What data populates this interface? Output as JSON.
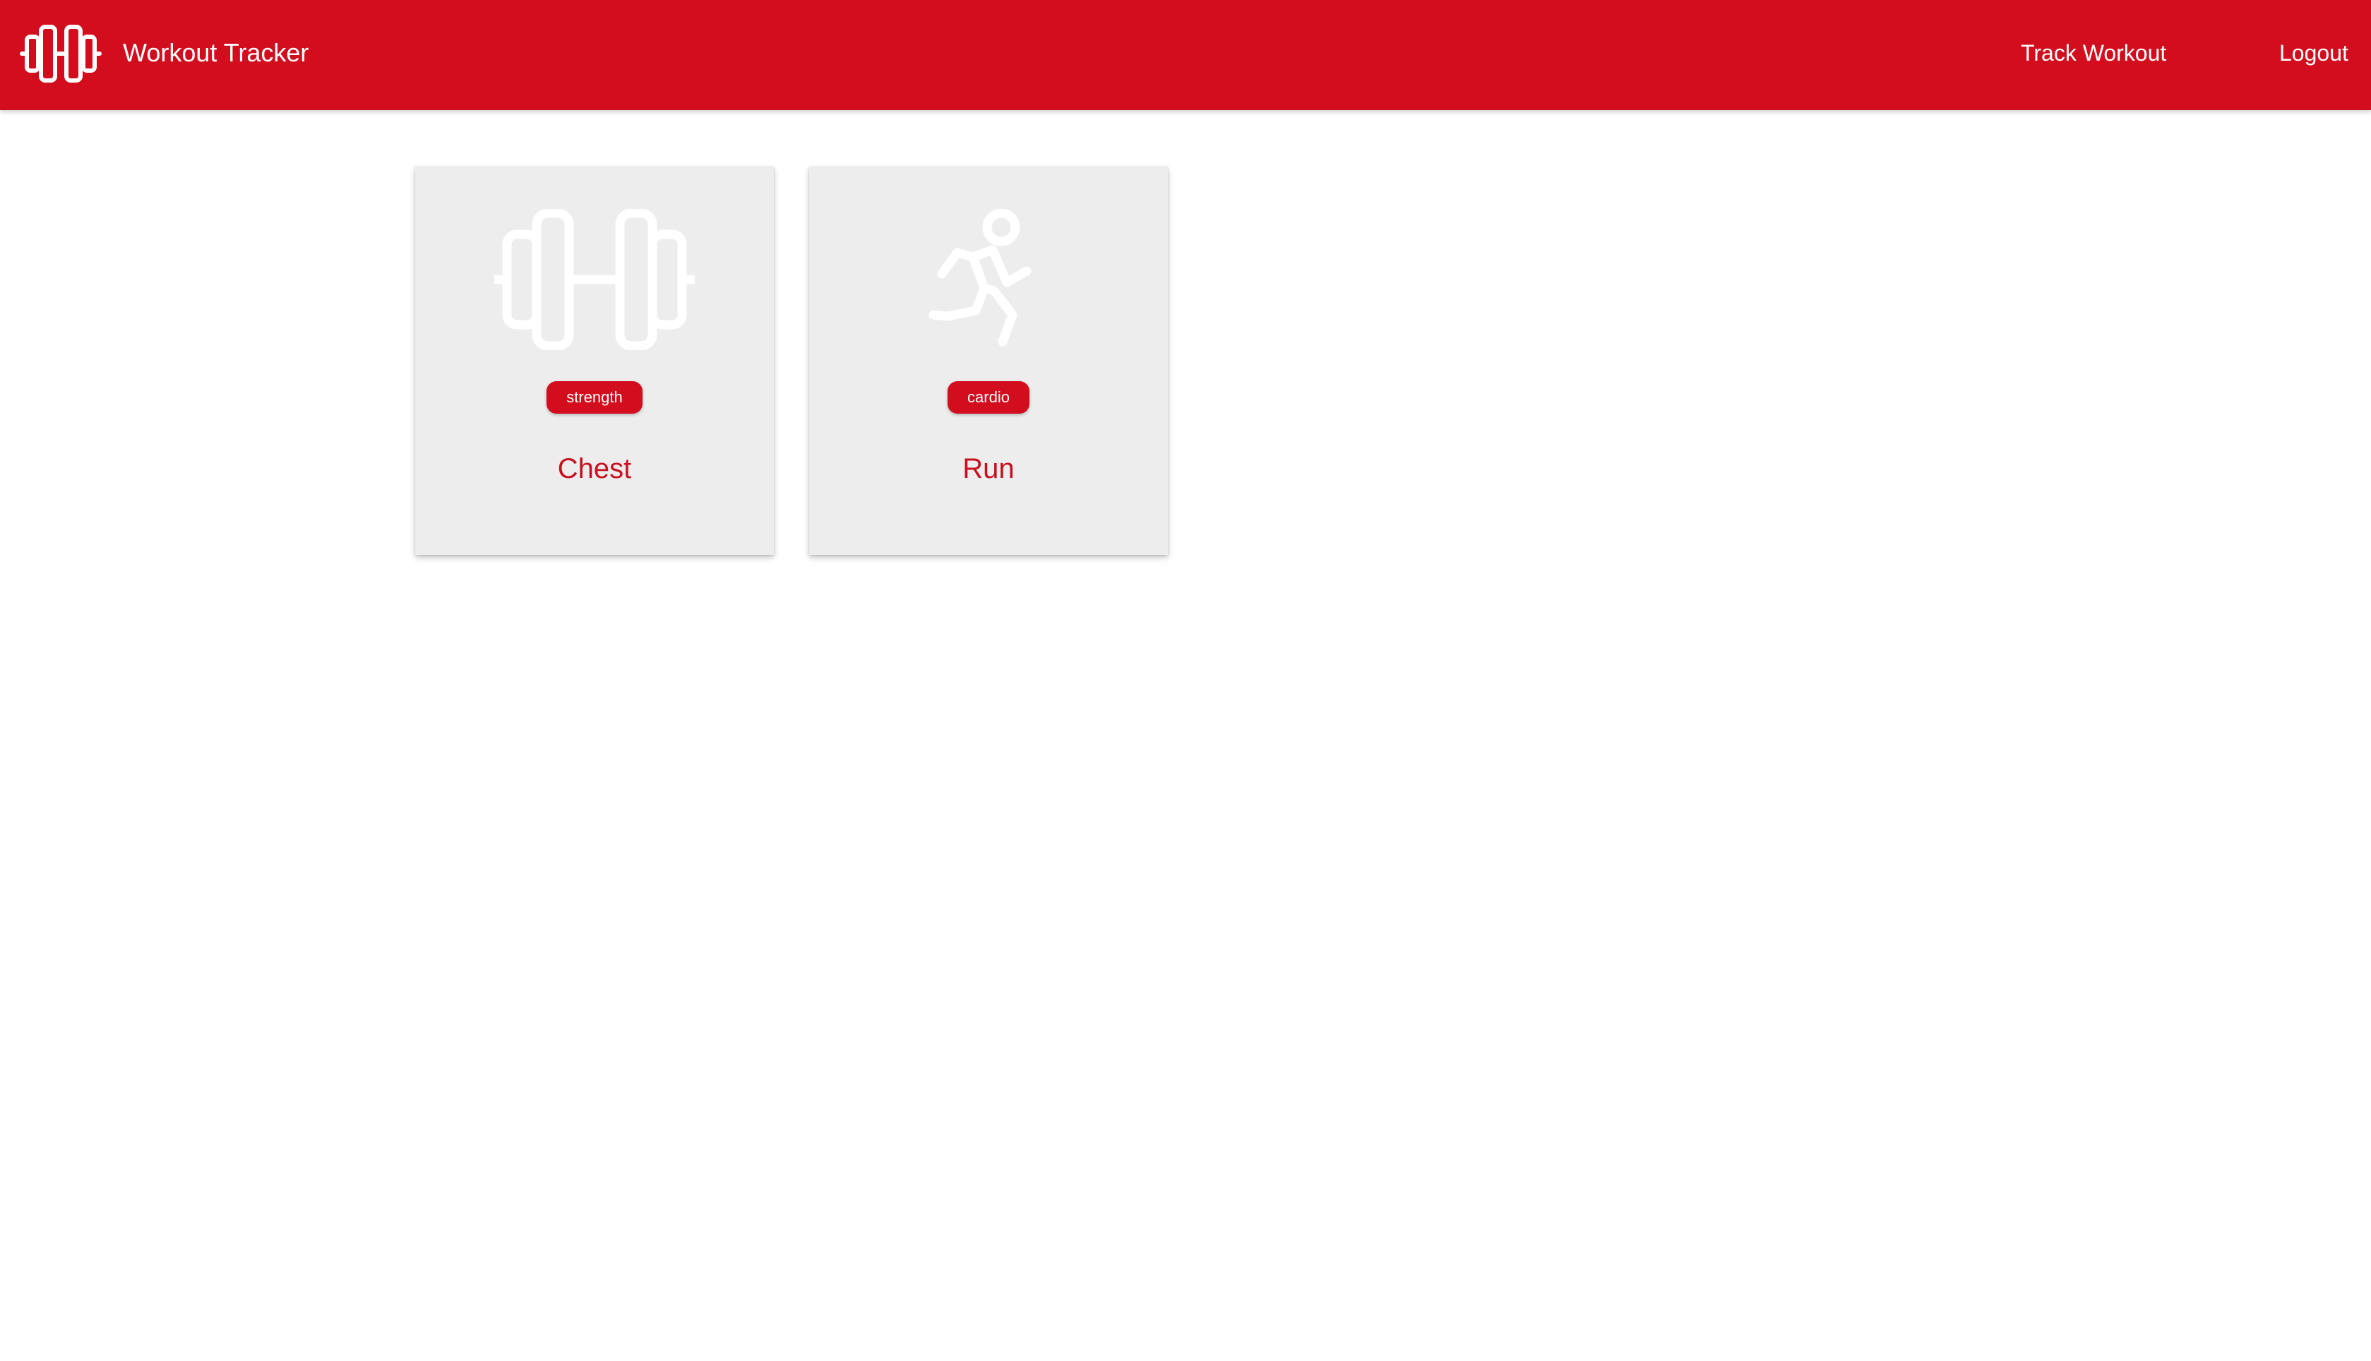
{
  "app": {
    "title": "Workout Tracker",
    "logo_icon": "dumbbell-icon",
    "accent_color": "#d20d1e"
  },
  "nav": {
    "links": [
      {
        "label": "Track Workout"
      },
      {
        "label": "Logout"
      }
    ]
  },
  "workouts": [
    {
      "name": "Chest",
      "category": "strength",
      "icon": "dumbbell-icon"
    },
    {
      "name": "Run",
      "category": "cardio",
      "icon": "running-person-icon"
    }
  ]
}
